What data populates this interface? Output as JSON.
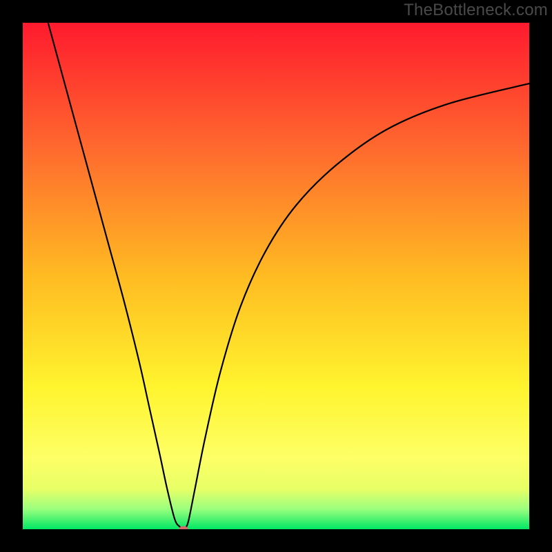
{
  "watermark_text": "TheBottleneck.com",
  "colors": {
    "frame": "#000000",
    "grad_top": "#ff1a2e",
    "grad_mid1": "#ff6a2e",
    "grad_mid2": "#ffbb22",
    "grad_mid3": "#fff42e",
    "grad_bottom_band1": "#e8ff66",
    "grad_bottom_band2": "#9bff7e",
    "grad_bottom_band3": "#00e864",
    "curve": "#000000",
    "marker_fill": "#d46a6a",
    "marker_stroke": "#000000"
  },
  "chart_data": {
    "type": "line",
    "title": "",
    "xlabel": "",
    "ylabel": "",
    "xlim": [
      0,
      100
    ],
    "ylim": [
      0,
      100
    ],
    "x": [
      5,
      8,
      11,
      14,
      17,
      20,
      23,
      25,
      27,
      28.5,
      30,
      31,
      31.8,
      32.3,
      32.8,
      34,
      36,
      39,
      43,
      48,
      54,
      62,
      72,
      84,
      100
    ],
    "values": [
      100,
      89,
      78,
      67,
      56,
      45,
      33,
      24,
      15,
      8,
      2,
      0.5,
      0,
      0.5,
      2,
      8,
      18,
      31,
      44,
      55,
      64,
      72,
      79,
      84,
      88
    ],
    "annotations": [],
    "marker": {
      "x": 31.8,
      "y": 0
    }
  }
}
